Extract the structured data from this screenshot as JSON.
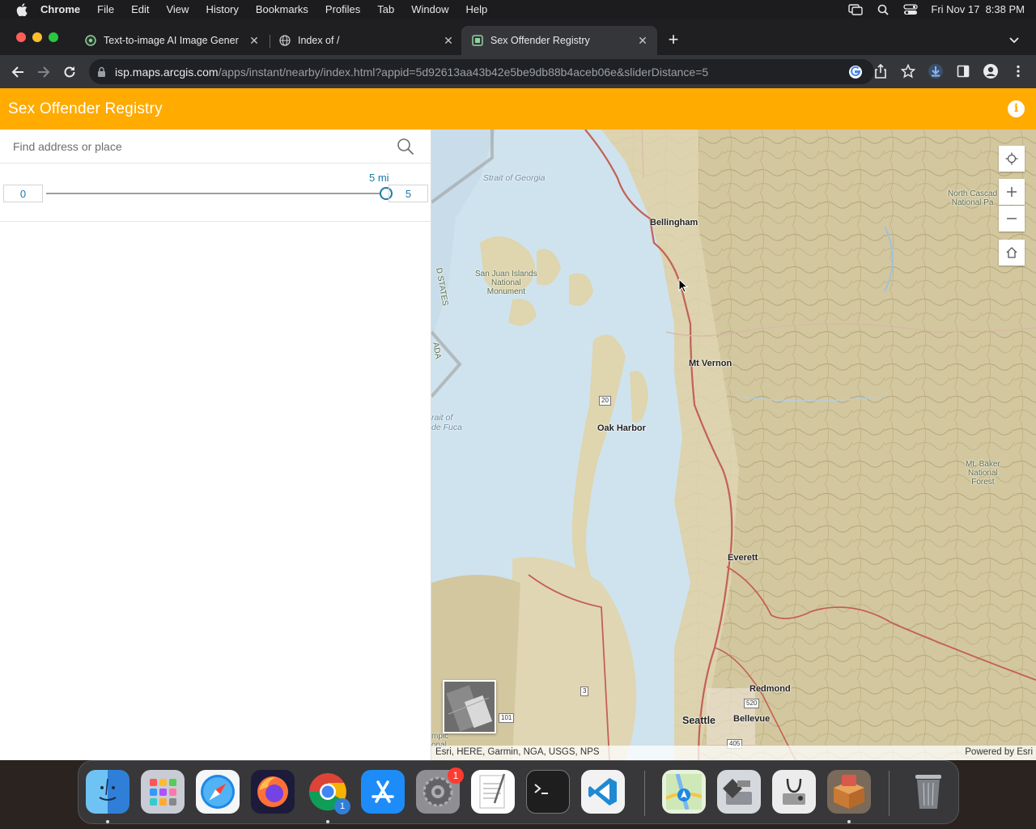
{
  "menubar": {
    "app_name": "Chrome",
    "items": [
      "File",
      "Edit",
      "View",
      "History",
      "Bookmarks",
      "Profiles",
      "Tab",
      "Window",
      "Help"
    ],
    "datetime": "Fri Nov 17  8:38 PM"
  },
  "tabs": [
    {
      "title": "Text-to-image AI Image Gener",
      "icon": "ai-generator-icon",
      "active": false
    },
    {
      "title": "Index of /",
      "icon": "globe-icon",
      "active": false
    },
    {
      "title": "Sex Offender Registry",
      "icon": "arcgis-icon",
      "active": true
    }
  ],
  "address_bar": {
    "host": "isp.maps.arcgis.com",
    "path": "/apps/instant/nearby/index.html?appid=5d92613aa43b42e5be9db88b4aceb06e&sliderDistance=5"
  },
  "app": {
    "title": "Sex Offender Registry",
    "accent_color": "#ffab00"
  },
  "search": {
    "placeholder": "Find address or place",
    "value": ""
  },
  "distance_slider": {
    "label": "5 mi",
    "min": "0",
    "max": "5",
    "value": 5
  },
  "map": {
    "water_labels": {
      "georgia": "Strait of Georgia",
      "fuca": "rait of\nde Fuca"
    },
    "park_labels": {
      "san_juan": "San Juan Islands\nNational\nMonument",
      "north_cascades": "North Cascad\nNational Pa",
      "mt_baker": "Mt. Baker\nNational\nForest"
    },
    "border_labels": {
      "states": "D STATES",
      "canada": "ADA"
    },
    "cities": {
      "bellingham": "Bellingham",
      "mt_vernon": "Mt Vernon",
      "oak_harbor": "Oak Harbor",
      "everett": "Everett",
      "redmond": "Redmond",
      "seattle": "Seattle",
      "bellevue": "Bellevue"
    },
    "shields": {
      "r20": "20",
      "r3": "3",
      "r101": "101",
      "r520": "520",
      "r405": "405"
    },
    "edge_text": {
      "olympic": "mpic\nonal"
    },
    "attribution": "Esri, HERE, Garmin, NGA, USGS, NPS",
    "powered_by": "Powered by Esri"
  },
  "dock": {
    "apps": [
      "Finder",
      "Launchpad",
      "Safari",
      "Firefox",
      "Chrome",
      "App Store",
      "System Settings",
      "TextEdit",
      "Terminal",
      "Visual Studio Code",
      "Maps",
      "Boot Camp Assistant",
      "Disk Utility",
      "Installer",
      "Trash"
    ],
    "settings_badge": "1",
    "chrome_badge": "1"
  }
}
